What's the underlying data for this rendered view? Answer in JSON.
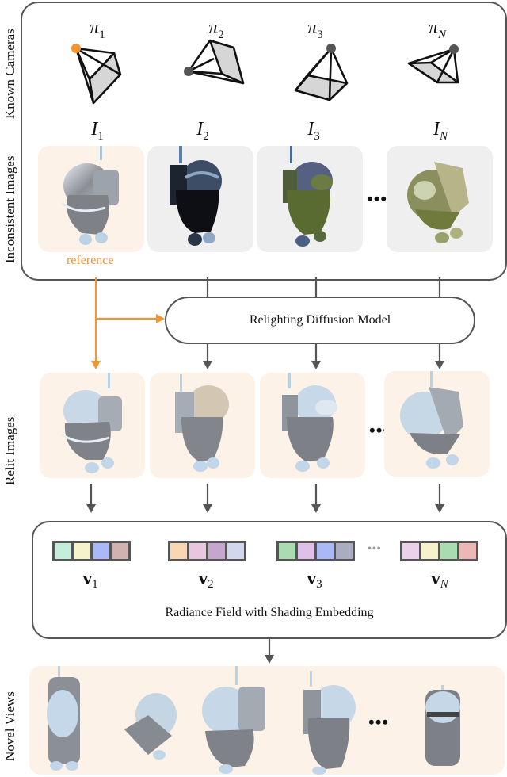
{
  "row_labels": {
    "known_cameras": "Known Cameras",
    "inconsistent_images": "Inconsistent Images",
    "relit_images": "Relit Images",
    "novel_views": "Novel Views"
  },
  "cameras": [
    {
      "label": "π",
      "sub": "1",
      "sub_italic": false,
      "center_color": "#f0952f"
    },
    {
      "label": "π",
      "sub": "2",
      "sub_italic": false,
      "center_color": "#555555"
    },
    {
      "label": "π",
      "sub": "3",
      "sub_italic": false,
      "center_color": "#555555"
    },
    {
      "label": "π",
      "sub": "N",
      "sub_italic": true,
      "center_color": "#555555"
    }
  ],
  "images": [
    {
      "label": "I",
      "sub": "1",
      "sub_italic": false,
      "background": "reference",
      "tint": "silver"
    },
    {
      "label": "I",
      "sub": "2",
      "sub_italic": false,
      "background": "grey",
      "tint": "dark"
    },
    {
      "label": "I",
      "sub": "3",
      "sub_italic": false,
      "background": "grey",
      "tint": "olive"
    },
    {
      "label": "I",
      "sub": "N",
      "sub_italic": true,
      "background": "grey",
      "tint": "olive-light"
    }
  ],
  "ellipsis": "•••",
  "reference_label": "reference",
  "relighting_model_label": "Relighting Diffusion Model",
  "radiance_field_label": "Radiance Field with Shading Embedding",
  "embeddings": [
    {
      "label": "v",
      "sub": "1",
      "sub_italic": false,
      "colors": [
        "#c4eedb",
        "#f6f3cc",
        "#a9b8f6",
        "#d2b1b1"
      ]
    },
    {
      "label": "v",
      "sub": "2",
      "sub_italic": false,
      "colors": [
        "#f9d7b2",
        "#e8c6e0",
        "#c5a6cc",
        "#d2d7ef"
      ]
    },
    {
      "label": "v",
      "sub": "3",
      "sub_italic": false,
      "colors": [
        "#a9dcae",
        "#e0bfe8",
        "#a9b8f6",
        "#a9adbf"
      ]
    },
    {
      "label": "v",
      "sub": "N",
      "sub_italic": true,
      "colors": [
        "#ecd1ea",
        "#f6f3cc",
        "#a9dcae",
        "#ecb7b7"
      ]
    }
  ],
  "embedding_ellipsis": "•••",
  "colors": {
    "reference_accent": "#f0952f",
    "arrow_grey": "#555555",
    "tile_reference_bg": "#fdf2e8",
    "tile_grey_bg": "#efefef"
  }
}
